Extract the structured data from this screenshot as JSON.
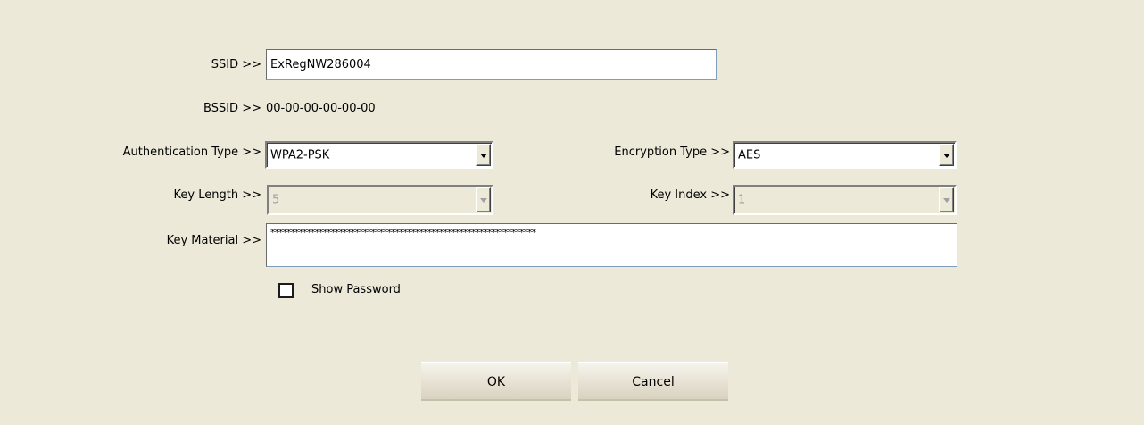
{
  "ssid": {
    "label": "SSID >>",
    "value": "ExRegNW286004"
  },
  "bssid": {
    "label": "BSSID >>",
    "value": "00-00-00-00-00-00"
  },
  "authentication": {
    "label": "Authentication Type >>",
    "value": "WPA2-PSK"
  },
  "encryption": {
    "label": "Encryption Type >>",
    "value": "AES"
  },
  "key_length": {
    "label": "Key Length >>",
    "value": "5",
    "enabled": false
  },
  "key_index": {
    "label": "Key Index >>",
    "value": "1",
    "enabled": false
  },
  "key_material": {
    "label": "Key Material >>",
    "value": "******************************************************************"
  },
  "show_password": {
    "label": "Show Password",
    "checked": false
  },
  "buttons": {
    "ok": "OK",
    "cancel": "Cancel"
  },
  "colors": {
    "background": "#ece9d8",
    "field_border": "#7f9db9"
  }
}
